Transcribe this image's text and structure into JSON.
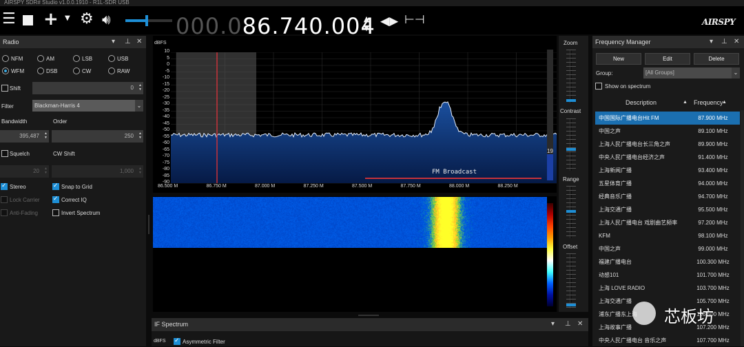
{
  "window": {
    "title": "AIRSPY SDR# Studio v1.0.0.1910 - R1L-SDR USB"
  },
  "toolbar": {
    "icons": [
      "menu-icon",
      "stop-icon",
      "add-icon",
      "chevron-down-icon",
      "gear-icon",
      "speaker-icon",
      "fast-tune-icon",
      "swap-icon",
      "step-icon"
    ],
    "freq_dim": "000.0",
    "freq_lit": "86.740.004",
    "freq_arrow_up": "▲",
    "freq_arrow_down": "▼",
    "brand": "AIRSPY",
    "volume": 0.45
  },
  "radio": {
    "title": "Radio",
    "modes": [
      {
        "label": "NFM",
        "selected": false
      },
      {
        "label": "AM",
        "selected": false
      },
      {
        "label": "LSB",
        "selected": false
      },
      {
        "label": "USB",
        "selected": false
      },
      {
        "label": "WFM",
        "selected": true
      },
      {
        "label": "DSB",
        "selected": false
      },
      {
        "label": "CW",
        "selected": false
      },
      {
        "label": "RAW",
        "selected": false
      }
    ],
    "shift_label": "Shift",
    "shift_value": "0",
    "filter_label": "Filter",
    "filter_value": "Blackman-Harris 4",
    "bandwidth_label": "Bandwidth",
    "order_label": "Order",
    "bandwidth_value": "395,487",
    "order_value": "250",
    "squelch_label": "Squelch",
    "cw_shift_label": "CW Shift",
    "squelch_value": "20",
    "cw_shift_value": "1,000",
    "stereo_label": "Stereo",
    "snap_label": "Snap to Grid",
    "lock_label": "Lock Carrier",
    "correct_iq_label": "Correct IQ",
    "anti_fading_label": "Anti-Fading",
    "invert_label": "Invert Spectrum"
  },
  "spectrum": {
    "unit_label": "dBFS",
    "y_ticks": [
      "10",
      "5",
      "0",
      "-5",
      "-10",
      "-15",
      "-20",
      "-25",
      "-30",
      "-35",
      "-40",
      "-45",
      "-50",
      "-55",
      "-60",
      "-65",
      "-70",
      "-75",
      "-80",
      "-85",
      "-90"
    ],
    "x_ticks": [
      "86.500 M",
      "86.750 M",
      "87.000 M",
      "87.250 M",
      "87.500 M",
      "87.750 M",
      "88.000 M",
      "88.250 M"
    ],
    "band_label": "FM Broadcast",
    "level_value": "19",
    "colors": {
      "trace": "#e8f1ff",
      "fill_top": "#1a4f9e",
      "fill_bottom": "#061a45",
      "vfo": "#c8323a",
      "band": "#c8323a"
    }
  },
  "sliders": {
    "zoom_label": "Zoom",
    "contrast_label": "Contrast",
    "range_label": "Range",
    "offset_label": "Offset"
  },
  "if_spectrum": {
    "title": "IF Spectrum",
    "unit_label": "dBFS",
    "asymmetric_label": "Asymmetric Filter"
  },
  "freq_manager": {
    "title": "Frequency Manager",
    "new_label": "New",
    "edit_label": "Edit",
    "delete_label": "Delete",
    "group_label": "Group:",
    "group_value": "[All Groups]",
    "show_label": "Show on spectrum",
    "col_desc": "Description",
    "col_freq": "Frequency",
    "sort_arrow": "▲",
    "rows": [
      {
        "desc": "中国国际广播电台Hit FM",
        "freq": "87.900 MHz",
        "selected": true
      },
      {
        "desc": "中国之声",
        "freq": "89.100 MHz"
      },
      {
        "desc": "上海人民广播电台长三角之声",
        "freq": "89.900 MHz"
      },
      {
        "desc": "中央人民广播电台经济之声",
        "freq": "91.400 MHz"
      },
      {
        "desc": "上海新闻广播",
        "freq": "93.400 MHz"
      },
      {
        "desc": "五星体育广播",
        "freq": "94.000 MHz"
      },
      {
        "desc": "经典音乐广播",
        "freq": "94.700 MHz"
      },
      {
        "desc": "上海交通广播",
        "freq": "95.500 MHz"
      },
      {
        "desc": "上海人民广播电台 戏剧曲艺频率",
        "freq": "97.200 MHz"
      },
      {
        "desc": "KFM",
        "freq": "98.100 MHz"
      },
      {
        "desc": "中国之声",
        "freq": "99.000 MHz"
      },
      {
        "desc": "福建广播电台",
        "freq": "100.300 MHz"
      },
      {
        "desc": "动感101",
        "freq": "101.700 MHz"
      },
      {
        "desc": "上海 LOVE RADIO",
        "freq": "103.700 MHz"
      },
      {
        "desc": "上海交通广播",
        "freq": "105.700 MHz"
      },
      {
        "desc": "浦东广播东上海",
        "freq": "106.500 MHz"
      },
      {
        "desc": "上海故事广播",
        "freq": "107.200 MHz"
      },
      {
        "desc": "中央人民广播电台 音乐之声",
        "freq": "107.700 MHz"
      }
    ]
  },
  "watermark": {
    "text": "芯板坊"
  }
}
